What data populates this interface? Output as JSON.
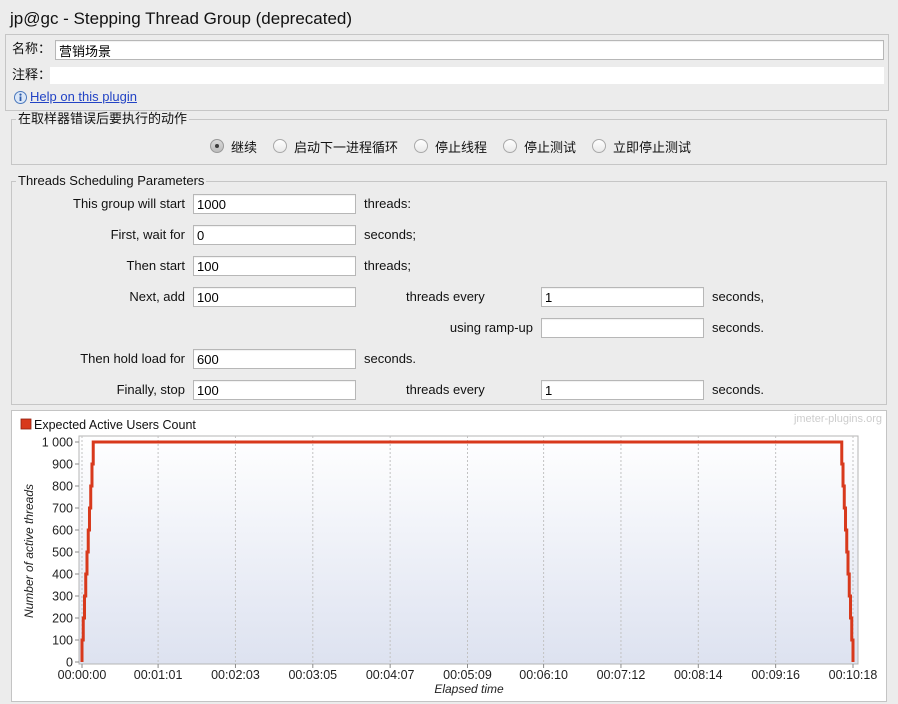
{
  "window": {
    "title": "jp@gc - Stepping Thread Group (deprecated)"
  },
  "general": {
    "name_label": "名称：",
    "name_value": "营销场景",
    "comment_label": "注释：",
    "comment_value": "",
    "help_icon": "info-icon",
    "help_link": "Help on this plugin"
  },
  "error_action": {
    "legend": "在取样器错误后要执行的动作",
    "options": [
      {
        "label": "继续",
        "selected": true
      },
      {
        "label": "启动下一进程循环",
        "selected": false
      },
      {
        "label": "停止线程",
        "selected": false
      },
      {
        "label": "停止测试",
        "selected": false
      },
      {
        "label": "立即停止测试",
        "selected": false
      }
    ]
  },
  "scheduling": {
    "legend": "Threads Scheduling Parameters",
    "rows": {
      "start": {
        "label": "This group will start",
        "value": "1000",
        "unit": "threads:"
      },
      "wait": {
        "label": "First, wait for",
        "value": "0",
        "unit": "seconds;"
      },
      "then_start": {
        "label": "Then start",
        "value": "100",
        "unit": "threads;"
      },
      "next_add": {
        "label": "Next, add",
        "value": "100",
        "middle": "threads every",
        "period": "1",
        "unit": "seconds,"
      },
      "ramp_up": {
        "label": "using ramp-up",
        "value": "",
        "unit": "seconds."
      },
      "hold": {
        "label": "Then hold load for",
        "value": "600",
        "unit": "seconds."
      },
      "stop": {
        "label": "Finally, stop",
        "value": "100",
        "middle": "threads every",
        "period": "1",
        "unit": "seconds."
      }
    }
  },
  "colors": {
    "link": "#2243c5",
    "selected_radio": "#bcbcbc"
  },
  "chart_data": {
    "type": "line",
    "xlabel": "Elapsed time",
    "ylabel": "Number of active threads",
    "xlim": [
      "00:00:00",
      "00:10:18"
    ],
    "ylim": [
      0,
      1000
    ],
    "x_ticks": [
      "00:00:00",
      "00:01:01",
      "00:02:03",
      "00:03:05",
      "00:04:07",
      "00:05:09",
      "00:06:10",
      "00:07:12",
      "00:08:14",
      "00:09:16",
      "00:10:18"
    ],
    "y_ticks": [
      0,
      100,
      200,
      300,
      400,
      500,
      600,
      700,
      800,
      900,
      1000
    ],
    "y_tick_labels": [
      "0",
      "100",
      "200",
      "300",
      "400",
      "500",
      "600",
      "700",
      "800",
      "900",
      "1 000"
    ],
    "grid_x": true,
    "grid_y": false,
    "legend_position": "top-left",
    "watermark": "jmeter-plugins.org",
    "background_gradient": [
      "#ffffff",
      "#dde2f0"
    ],
    "series": [
      {
        "name": "Expected Active Users Count",
        "color": "#d8391c",
        "stepped": true,
        "points": [
          [
            "00:00:00",
            0
          ],
          [
            "00:00:00",
            100
          ],
          [
            "00:00:01",
            200
          ],
          [
            "00:00:02",
            300
          ],
          [
            "00:00:03",
            400
          ],
          [
            "00:00:04",
            500
          ],
          [
            "00:00:05",
            600
          ],
          [
            "00:00:06",
            700
          ],
          [
            "00:00:07",
            800
          ],
          [
            "00:00:08",
            900
          ],
          [
            "00:00:09",
            1000
          ],
          [
            "00:10:09",
            900
          ],
          [
            "00:10:10",
            800
          ],
          [
            "00:10:11",
            700
          ],
          [
            "00:10:12",
            600
          ],
          [
            "00:10:13",
            500
          ],
          [
            "00:10:14",
            400
          ],
          [
            "00:10:15",
            300
          ],
          [
            "00:10:16",
            200
          ],
          [
            "00:10:17",
            100
          ],
          [
            "00:10:18",
            0
          ]
        ]
      }
    ]
  }
}
